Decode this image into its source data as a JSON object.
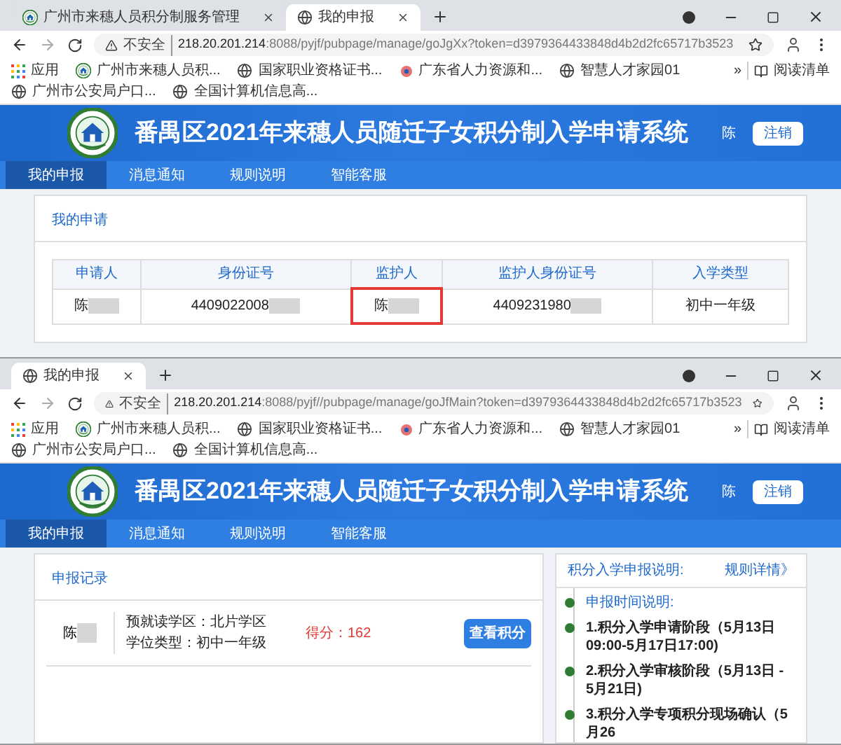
{
  "windows": [
    {
      "tabs": [
        {
          "title": "广州市来穗人员积分制服务管理",
          "selected": false,
          "kind": "emblem"
        },
        {
          "title": "我的申报",
          "selected": true,
          "kind": "globe"
        }
      ],
      "address": {
        "security": "不安全",
        "host": "218.20.201.214",
        "rest": ":8088/pyjf/pubpage/manage/goJgXx?token=d3979364433848d4b2d2fc65717b3523"
      },
      "bookmarks": [
        {
          "label": "应用",
          "kind": "apps"
        },
        {
          "label": "广州市来穗人员积...",
          "kind": "emblem"
        },
        {
          "label": "国家职业资格证书...",
          "kind": "globe"
        },
        {
          "label": "广东省人力资源和...",
          "kind": "flower"
        },
        {
          "label": "智慧人才家园01",
          "kind": "globe"
        },
        {
          "label": "广州市公安局户口...",
          "kind": "globe"
        },
        {
          "label": "全国计算机信息高...",
          "kind": "globe"
        }
      ],
      "bookmarks_more": "»",
      "reading_list": "阅读清单",
      "page": {
        "title": "番禺区2021年来穗人员随迁子女积分制入学申请系统",
        "user": "陈",
        "logout": "注销",
        "nav": [
          {
            "label": "我的申报",
            "selected": true
          },
          {
            "label": "消息通知",
            "selected": false
          },
          {
            "label": "规则说明",
            "selected": false
          },
          {
            "label": "智能客服",
            "selected": false
          }
        ],
        "kind": "table",
        "card_title": "我的申请",
        "columns": [
          "申请人",
          "身份证号",
          "监护人",
          "监护人身份证号",
          "入学类型"
        ],
        "rows": [
          [
            {
              "text": "陈",
              "redacted": true,
              "highlighted": false
            },
            {
              "text": "4409022008",
              "redacted": true,
              "highlighted": false
            },
            {
              "text": "陈",
              "redacted": true,
              "highlighted": true
            },
            {
              "text": "4409231980",
              "redacted": true,
              "highlighted": false
            },
            {
              "text": "初中一年级",
              "redacted": false,
              "highlighted": false
            }
          ]
        ]
      }
    },
    {
      "tabs": [
        {
          "title": "我的申报",
          "selected": true,
          "kind": "globe"
        }
      ],
      "address": {
        "security": "不安全",
        "host": "218.20.201.214",
        "rest": ":8088/pyjf//pubpage/manage/goJfMain?token=d3979364433848d4b2d2fc65717b3523"
      },
      "bookmarks": [
        {
          "label": "应用",
          "kind": "apps"
        },
        {
          "label": "广州市来穗人员积...",
          "kind": "emblem"
        },
        {
          "label": "国家职业资格证书...",
          "kind": "globe"
        },
        {
          "label": "广东省人力资源和...",
          "kind": "flower"
        },
        {
          "label": "智慧人才家园01",
          "kind": "globe"
        },
        {
          "label": "广州市公安局户口...",
          "kind": "globe"
        },
        {
          "label": "全国计算机信息高...",
          "kind": "globe"
        }
      ],
      "bookmarks_more": "»",
      "reading_list": "阅读清单",
      "page": {
        "title": "番禺区2021年来穗人员随迁子女积分制入学申请系统",
        "user": "陈",
        "logout": "注销",
        "nav": [
          {
            "label": "我的申报",
            "selected": true
          },
          {
            "label": "消息通知",
            "selected": false
          },
          {
            "label": "规则说明",
            "selected": false
          },
          {
            "label": "智能客服",
            "selected": false
          }
        ],
        "kind": "records",
        "card_title": "申报记录",
        "records": [
          {
            "name": "陈",
            "district": "预就读学区：北片学区",
            "degree": "学位类型：初中一年级",
            "score": "得分：162",
            "button": "查看积分"
          }
        ],
        "side_title": "积分入学申报说明:",
        "side_link": "规则详情》",
        "timeline": [
          {
            "kind": "heading",
            "text": "申报时间说明:"
          },
          {
            "kind": "step",
            "text": "1.积分入学申请阶段（5月13日09:00-5月17日17:00)"
          },
          {
            "kind": "step",
            "text": "2.积分入学审核阶段（5月13日 - 5月21日)"
          },
          {
            "kind": "step",
            "text": "3.积分入学专项积分现场确认（5月26"
          }
        ]
      }
    }
  ]
}
